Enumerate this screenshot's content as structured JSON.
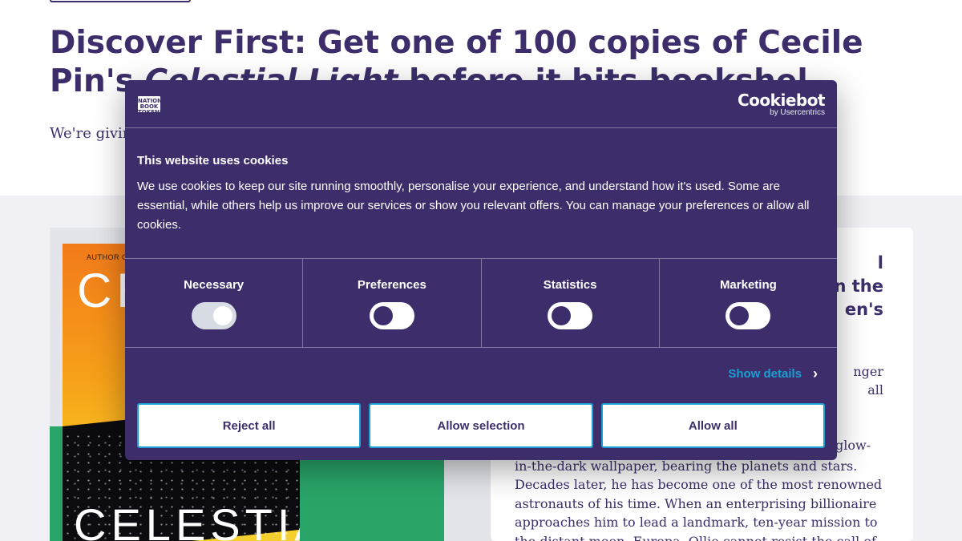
{
  "page": {
    "headline_part1": "Discover First: Get one of 100 copies of Cecile",
    "headline_part2": "Pin's ",
    "headline_italic": "Celestial Light",
    "headline_part3": " before it hits bookshel",
    "intro_text": "We're givin",
    "book_cover": {
      "author_line": "AUTHOR OF",
      "author_initials": "CE",
      "title_text": "CELESTIAL"
    },
    "right_card": {
      "heading_lines": [
        "l",
        "n the",
        "en's"
      ],
      "side_lines": [
        "nger",
        "all"
      ],
      "glow_fragment": "glow-",
      "body_lines": [
        "in-the-dark wallpaper, bearing the planets and stars.",
        "Decades later, he has become one of the most renowned",
        "astronauts of his time. When an enterprising billionaire",
        "approaches him to lead a landmark, ten-year mission to",
        "the distant moon, Europa, Ollie cannot resist the call of"
      ]
    }
  },
  "cookie_dialog": {
    "brand_logo": "NATIONAL BOOK TOKENS",
    "cookiebot_name": "Cookiebot",
    "cookiebot_sub": "by Usercentrics",
    "title": "This website uses cookies",
    "body": "We use cookies to keep our site running smoothly, personalise your experience, and understand how it's used. Some are essential, while others help us improve our services or show you relevant offers. You can manage your preferences or allow all cookies.",
    "categories": [
      {
        "label": "Necessary",
        "enabled": true,
        "locked": true
      },
      {
        "label": "Preferences",
        "enabled": false,
        "locked": false
      },
      {
        "label": "Statistics",
        "enabled": false,
        "locked": false
      },
      {
        "label": "Marketing",
        "enabled": false,
        "locked": false
      }
    ],
    "show_details": "Show details",
    "buttons": {
      "reject": "Reject all",
      "selection": "Allow selection",
      "allow": "Allow all"
    },
    "colors": {
      "dialog_bg": "#3d2e6b",
      "accent": "#1a9fd4",
      "green_panel": "#2aa56a"
    }
  }
}
